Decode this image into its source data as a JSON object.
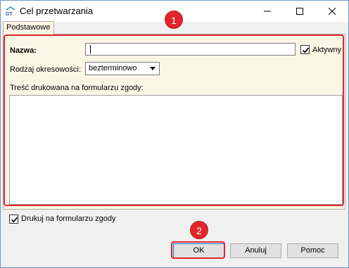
{
  "window": {
    "title": "Cel przetwarzania",
    "icon": "app-logo-icon",
    "controls": [
      "minimize-icon",
      "maximize-icon",
      "close-icon"
    ]
  },
  "tabs": [
    {
      "label": "Podstawowe",
      "active": true
    }
  ],
  "form": {
    "nazwa_label": "Nazwa:",
    "nazwa_value": "",
    "aktywny_label": "Aktywny",
    "aktywny_checked": true,
    "rodzaj_label": "Rodzaj okresowości:",
    "rodzaj_value": "bezterminowo",
    "tresc_label": "Treść drukowana na formularzu zgody:",
    "tresc_value": ""
  },
  "drukuj": {
    "label": "Drukuj na formularzu zgody",
    "checked": true
  },
  "buttons": {
    "ok": "OK",
    "anuluj": "Anuluj",
    "pomoc": "Pomoc"
  },
  "annotations": {
    "badge1": "1",
    "badge2": "2",
    "color": "#e0262b"
  }
}
